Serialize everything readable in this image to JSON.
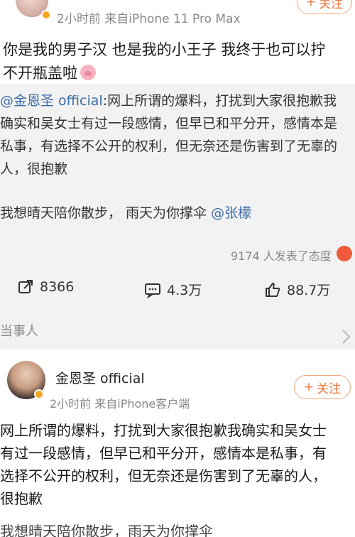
{
  "post": {
    "meta": "2小时前  来自iPhone 11 Pro Max",
    "follow_label": "关注",
    "text_line1": "你是我的男子汉  也是我的小王子  我终于也可以拧",
    "text_line2": "不开瓶盖啦",
    "quote": {
      "mention": "@金恩圣 official",
      "line1_rest": ":网上所谓的爆料，打扰到大家很抱歉我",
      "line2": "确实和吴女士有过一段感情，但早已和平分开，感情本是",
      "line3": "私事，有选择不公开的权利，但无奈还是伤害到了无辜的",
      "line4": "人，很抱歉",
      "line5_text": "我想晴天陪你散步，  雨天为你撑伞 ",
      "line5_mention": "@张檬"
    },
    "reactions_text": "9174 人发表了态度",
    "actions": {
      "repost": "8366",
      "comment": "4.3万",
      "like": "88.7万"
    }
  },
  "section": {
    "title": "当事人"
  },
  "author_post": {
    "username": "金恩圣 official",
    "meta": "2小时前  来自iPhone客户端",
    "follow_label": "关注",
    "line1": "网上所谓的爆料，打扰到大家很抱歉我确实和吴女士",
    "line2": "有过一段感情，但早已和平分开，感情本是私事，有",
    "line3": "选择不公开的权利，但无奈还是伤害到了无辜的人，",
    "line4": "很抱歉",
    "line5": "我想晴天陪你散步，雨天为你撑伞"
  },
  "colors": {
    "accent_orange": "#e8743a",
    "link_blue": "#3d6da8",
    "quote_bg": "#f2f2f2"
  }
}
